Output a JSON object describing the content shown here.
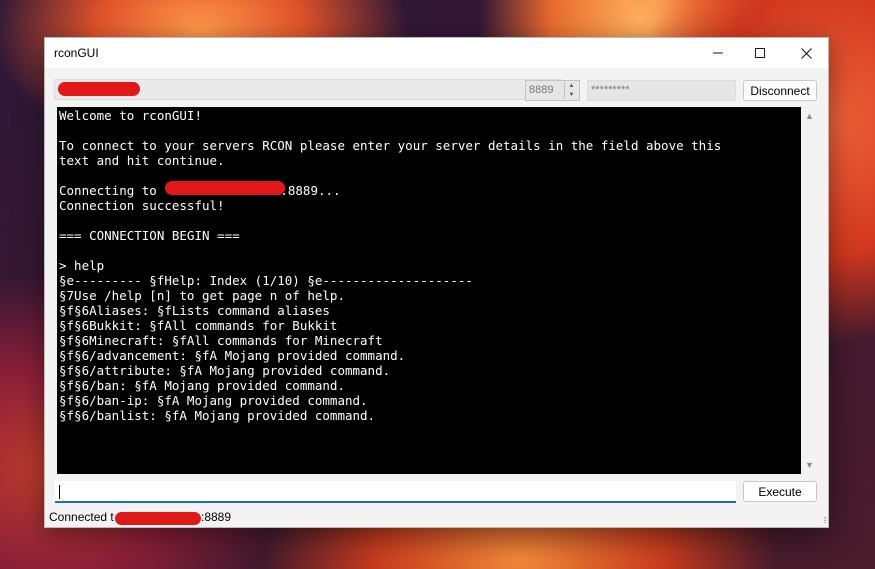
{
  "window": {
    "title": "rconGUI"
  },
  "connection": {
    "host_value": "",
    "port_value": "8889",
    "password_value": "*********",
    "disconnect_label": "Disconnect"
  },
  "console": {
    "lines": [
      "Welcome to rconGUI!",
      "",
      "To connect to your servers RCON please enter your server details in the field above this",
      "text and hit continue.",
      "",
      "Connecting to ",
      "Connection successful!",
      "",
      "=== CONNECTION BEGIN ===",
      "",
      "> help",
      "§e--------- §fHelp: Index (1/10) §e--------------------",
      "§7Use /help [n] to get page n of help.",
      "§f§6Aliases: §fLists command aliases",
      "§f§6Bukkit: §fAll commands for Bukkit",
      "§f§6Minecraft: §fAll commands for Minecraft",
      "§f§6/advancement: §fA Mojang provided command.",
      "§f§6/attribute: §fA Mojang provided command.",
      "§f§6/ban: §fA Mojang provided command.",
      "§f§6/ban-ip: §fA Mojang provided command.",
      "§f§6/banlist: §fA Mojang provided command."
    ],
    "connecting_port_suffix": ":8889..."
  },
  "command": {
    "value": "",
    "execute_label": "Execute"
  },
  "status": {
    "prefix": "Connected t",
    "port_suffix": ":8889"
  },
  "colors": {
    "console_bg": "#000000",
    "console_fg": "#ffffff",
    "redaction": "#e01818",
    "accent": "#1f6fb5"
  }
}
